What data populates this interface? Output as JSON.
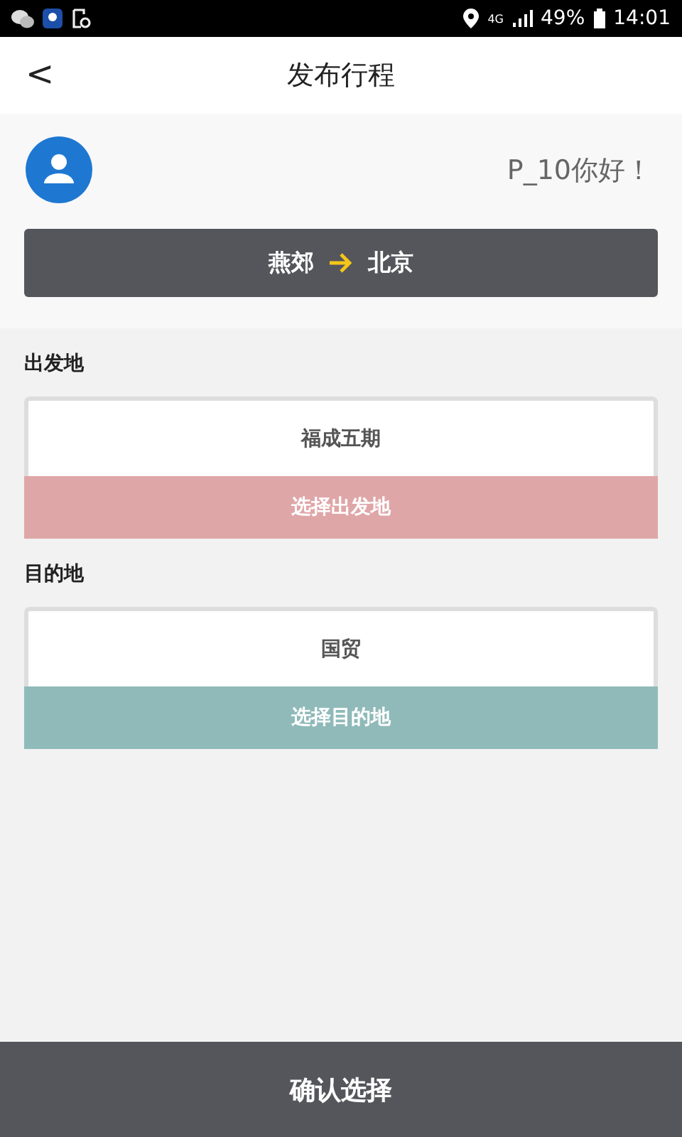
{
  "status_bar": {
    "network": "4G",
    "battery": "49%",
    "time": "14:01"
  },
  "header": {
    "back": "<",
    "title": "发布行程"
  },
  "profile": {
    "greeting": "P_10你好！"
  },
  "route": {
    "from": "燕郊",
    "to": "北京"
  },
  "sections": [
    {
      "label": "出发地",
      "value": "福成五期",
      "button": "选择出发地",
      "color": "#dfa6a8"
    },
    {
      "label": "目的地",
      "value": "国贸",
      "button": "选择目的地",
      "color": "#8fbab9"
    }
  ],
  "confirm_button": "确认选择"
}
